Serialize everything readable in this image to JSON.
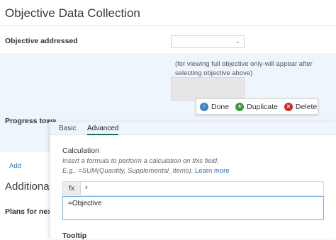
{
  "page": {
    "title": "Objective Data Collection",
    "additional_heading": "Additional"
  },
  "form": {
    "objective_label": "Objective addressed",
    "objective_hint": "(for viewing full objective only-will appear after selecting objective above)",
    "progress_label": "Progress towa",
    "add_link": "Add",
    "plans_label": "Plans for next"
  },
  "toolbar": {
    "done": "Done",
    "duplicate": "Duplicate",
    "delete": "Delete"
  },
  "editor": {
    "tabs": [
      {
        "label": "Basic",
        "active": false
      },
      {
        "label": "Advanced",
        "active": true
      }
    ],
    "calculation_heading": "Calculation",
    "help_line1": "Insert a formula to perform a calculation on this field.",
    "help_line2": "E.g., =SUM(Quantity, Supplemental_Items).",
    "learn_more": "Learn more",
    "fx_label": "fx",
    "fx_chevron": "›",
    "formula_value": "=Objective",
    "tooltip_heading": "Tooltip"
  },
  "colors": {
    "panel_bg": "#eef5fc",
    "done_icon": "#3b86c6",
    "duplicate_icon": "#3a9b3a",
    "delete_icon": "#cc2b2b",
    "link": "#2a74b8",
    "active_tab_underline": "#1f6e5a"
  }
}
